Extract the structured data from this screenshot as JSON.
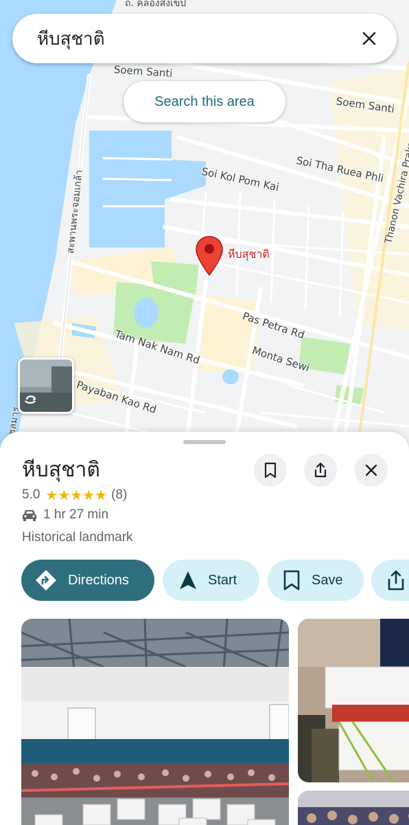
{
  "search": {
    "query": "หีบสุชาติ"
  },
  "map": {
    "search_area_label": "Search this area",
    "pin_label": "หีบสุชาติ",
    "road_labels": [
      "ถ. คลองสงเขป",
      "Soem Santi",
      "Soem Santi",
      "Soi Tha Ruea Phli",
      "Soi Kol Pom Kai",
      "สะพานพระจอมเกล้า",
      "Thanon Vachira Prakarn",
      "Pas Petra Rd",
      "Tam Nak Nam Rd",
      "Monta Sewi",
      "Payaban Kao Rd",
      "ถนนชลมาร"
    ],
    "colors": {
      "water": "#aadaff",
      "park": "#c3ecb2",
      "sand": "#fdf3d4",
      "land": "#f1f3f4",
      "road": "#ffffff",
      "pin": "#ea4335"
    }
  },
  "place": {
    "title": "หีบสุชาติ",
    "rating": "5.0",
    "stars": "★★★★★",
    "review_count": "(8)",
    "travel_time": "1 hr 27 min",
    "category": "Historical landmark",
    "icons": {
      "bookmark": "bookmark-icon",
      "share": "share-icon",
      "close": "close-icon",
      "car": "car-icon"
    }
  },
  "actions": {
    "directions": "Directions",
    "start": "Start",
    "save": "Save"
  },
  "colors": {
    "primary": "#2e6e7e",
    "secondary_bg": "#d6f0f8",
    "star": "#f4b400"
  }
}
